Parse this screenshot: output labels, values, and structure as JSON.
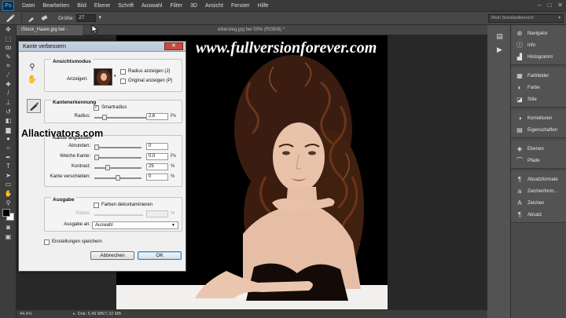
{
  "app": {
    "logo": "Ps",
    "menus": [
      "Datei",
      "Bearbeiten",
      "Bild",
      "Ebene",
      "Schrift",
      "Auswahl",
      "Filter",
      "3D",
      "Ansicht",
      "Fenster",
      "Hilfe"
    ],
    "window_controls": [
      "–",
      "□",
      "✕"
    ]
  },
  "options_bar": {
    "size_label": "Größe:",
    "size_value": "27",
    "workspace": "Mein Standardbereich"
  },
  "tools": [
    {
      "name": "move-tool",
      "glyph": "✥"
    },
    {
      "name": "marquee-tool",
      "glyph": "⬚"
    },
    {
      "name": "lasso-tool",
      "glyph": "ꝏ"
    },
    {
      "name": "quick-select-tool",
      "glyph": "✎"
    },
    {
      "name": "crop-tool",
      "glyph": "⌗"
    },
    {
      "name": "eyedropper-tool",
      "glyph": "⁄"
    },
    {
      "name": "healing-tool",
      "glyph": "✚"
    },
    {
      "name": "brush-tool",
      "glyph": "/"
    },
    {
      "name": "stamp-tool",
      "glyph": "⊥"
    },
    {
      "name": "history-brush-tool",
      "glyph": "↺"
    },
    {
      "name": "eraser-tool",
      "glyph": "◧"
    },
    {
      "name": "gradient-tool",
      "glyph": "▆"
    },
    {
      "name": "blur-tool",
      "glyph": "●"
    },
    {
      "name": "dodge-tool",
      "glyph": "○"
    },
    {
      "name": "pen-tool",
      "glyph": "✒"
    },
    {
      "name": "type-tool",
      "glyph": "T"
    },
    {
      "name": "path-select-tool",
      "glyph": "➤"
    },
    {
      "name": "shape-tool",
      "glyph": "▭"
    },
    {
      "name": "hand-tool",
      "glyph": "✋"
    },
    {
      "name": "zoom-tool",
      "glyph": "⚲"
    }
  ],
  "extra_tools": [
    {
      "name": "quickmask-tool",
      "glyph": "◙"
    },
    {
      "name": "screen-mode-tool",
      "glyph": "▣"
    }
  ],
  "document": {
    "tab_active": "iStock_Haare.jpg bei -",
    "tab_other": "eikersteg.jpg bei 50% (RGB/8) *",
    "zoom": "44,4%",
    "doc_info": "Dok: 5,49 MB/7,32 MB"
  },
  "panels": {
    "group1": [
      {
        "label": "Navigator",
        "icon": "navigator-icon",
        "glyph": "⊛"
      },
      {
        "label": "Info",
        "icon": "info-icon",
        "glyph": "ⓘ"
      },
      {
        "label": "Histogramm",
        "icon": "histogram-icon",
        "glyph": "▟"
      }
    ],
    "group2": [
      {
        "label": "Farbfelder",
        "icon": "swatches-icon",
        "glyph": "▦"
      },
      {
        "label": "Farbe",
        "icon": "color-icon",
        "glyph": "◐"
      },
      {
        "label": "Stile",
        "icon": "styles-icon",
        "glyph": "◪"
      }
    ],
    "group3": [
      {
        "label": "Korrekturen",
        "icon": "adjustments-icon",
        "glyph": "◑"
      },
      {
        "label": "Eigenschaften",
        "icon": "properties-icon",
        "glyph": "▤"
      }
    ],
    "group4": [
      {
        "label": "Ebenen",
        "icon": "layers-icon",
        "glyph": "◈"
      },
      {
        "label": "Pfade",
        "icon": "paths-icon",
        "glyph": "⌒"
      }
    ],
    "group5": [
      {
        "label": "Absatzformate",
        "icon": "paragraph-styles-icon",
        "glyph": "¶"
      },
      {
        "label": "Zeichenform...",
        "icon": "character-styles-icon",
        "glyph": "a"
      },
      {
        "label": "Zeichen",
        "icon": "character-icon",
        "glyph": "A"
      },
      {
        "label": "Absatz",
        "icon": "paragraph-icon",
        "glyph": "¶"
      }
    ]
  },
  "dialog": {
    "title": "Kante verbessern",
    "close": "✕",
    "view_mode": {
      "heading": "Ansichtsmodus",
      "view_label": "Anzeigen:",
      "show_radius": "Radius anzeigen (J)",
      "show_original": "Original anzeigen (P)"
    },
    "edge_detection": {
      "heading": "Kantenerkennung",
      "smart_radius": "Smartradius",
      "radius_label": "Radius:",
      "radius_value": "2,6",
      "radius_unit": "Px",
      "radius_fraction": 0.13
    },
    "adjust_edge": {
      "heading": "Kante anpassen",
      "rows": [
        {
          "label": "Abrunden:",
          "value": "0",
          "unit": "",
          "fraction": 0.0
        },
        {
          "label": "Weiche Kante:",
          "value": "0,0",
          "unit": "Px",
          "fraction": 0.0
        },
        {
          "label": "Kontrast:",
          "value": "25",
          "unit": "%",
          "fraction": 0.25
        },
        {
          "label": "Kante verschieben:",
          "value": "0",
          "unit": "%",
          "fraction": 0.5
        }
      ]
    },
    "output": {
      "heading": "Ausgabe",
      "decontaminate": "Farben dekontaminieren",
      "strength_label": "Stärke:",
      "strength_unit": "%",
      "output_to_label": "Ausgabe an:",
      "output_to_value": "Auswahl"
    },
    "remember": "Einstellungen speichern",
    "cancel": "Abbrechen",
    "ok": "OK"
  },
  "watermarks": {
    "top": "www.fullversionforever.com",
    "left": "Allactivators.com"
  }
}
